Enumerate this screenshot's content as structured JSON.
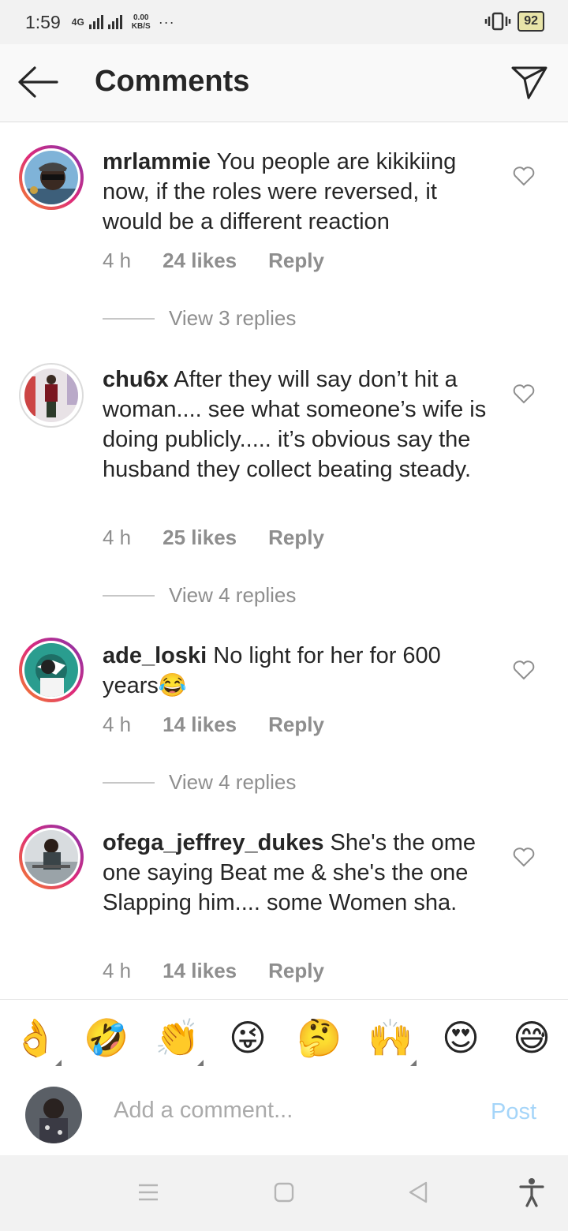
{
  "status": {
    "time": "1:59",
    "network": "4G",
    "speed_value": "0.00",
    "speed_unit": "KB/S",
    "dots": "···",
    "battery": "92"
  },
  "header": {
    "title": "Comments"
  },
  "comments": [
    {
      "username": "mrlammie",
      "text": "You people are kikikiing now, if the roles were reversed, it would be a different reaction",
      "time": "4 h",
      "likes": "24 likes",
      "reply": "Reply",
      "view_replies": "View 3 replies"
    },
    {
      "username": "chu6x",
      "text": "After they will say don’t hit a woman.... see what someone’s wife is doing publicly..... it’s obvious say the husband they collect beating steady.",
      "time": "4 h",
      "likes": "25 likes",
      "reply": "Reply",
      "view_replies": "View 4 replies"
    },
    {
      "username": "ade_loski",
      "text": "No light for her for 600 years😂",
      "time": "4 h",
      "likes": "14 likes",
      "reply": "Reply",
      "view_replies": "View 4 replies"
    },
    {
      "username": "ofega_jeffrey_dukes",
      "text": "She's the ome one saying Beat me & she's the one Slapping him.... some Women sha.",
      "time": "4 h",
      "likes": "14 likes",
      "reply": "Reply"
    }
  ],
  "emojis": [
    "👌",
    "🤣",
    "👏",
    "😜",
    "🤔",
    "🙌",
    "😍",
    "😅"
  ],
  "input": {
    "placeholder": "Add a comment...",
    "post_label": "Post"
  },
  "colors": {
    "accent_post": "#a5d5f9",
    "ring_start": "#f58529",
    "ring_mid": "#dd2a7b",
    "ring_end": "#8134af",
    "meta_gray": "#8e8e8e"
  }
}
